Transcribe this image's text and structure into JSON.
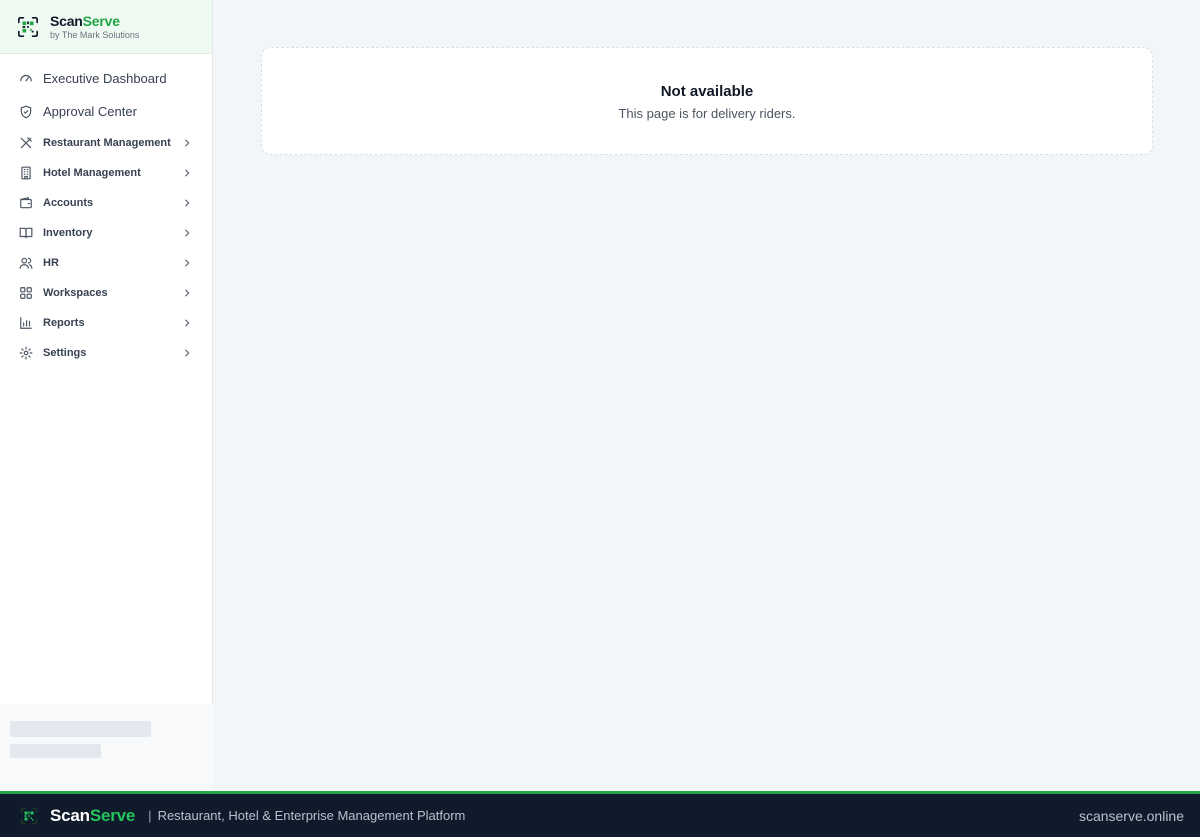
{
  "brand": {
    "name_part1": "Scan",
    "name_part2": "Serve",
    "subtitle": "by The Mark Solutions",
    "accent_color": "#22a447",
    "logo_icon": "qr-scan-icon"
  },
  "sidebar": {
    "top_items": [
      {
        "label": "Executive Dashboard",
        "icon": "gauge-icon"
      },
      {
        "label": "Approval Center",
        "icon": "shield-check-icon"
      }
    ],
    "groups": [
      {
        "label": "Restaurant Management",
        "icon": "utensils-icon"
      },
      {
        "label": "Hotel Management",
        "icon": "building-icon"
      },
      {
        "label": "Accounts",
        "icon": "wallet-icon"
      },
      {
        "label": "Inventory",
        "icon": "book-icon"
      },
      {
        "label": "HR",
        "icon": "users-icon"
      },
      {
        "label": "Workspaces",
        "icon": "grid-icon"
      },
      {
        "label": "Reports",
        "icon": "bar-chart-icon"
      },
      {
        "label": "Settings",
        "icon": "gear-icon"
      }
    ]
  },
  "main": {
    "title": "Not available",
    "message": "This page is for delivery riders."
  },
  "footer": {
    "brand_part1": "Scan",
    "brand_part2": "Serve",
    "separator": "|",
    "tagline": "Restaurant, Hotel & Enterprise Management Platform",
    "domain": "scanserve.online",
    "background_color": "#0f1b2b",
    "accent_color": "#22c55e"
  }
}
